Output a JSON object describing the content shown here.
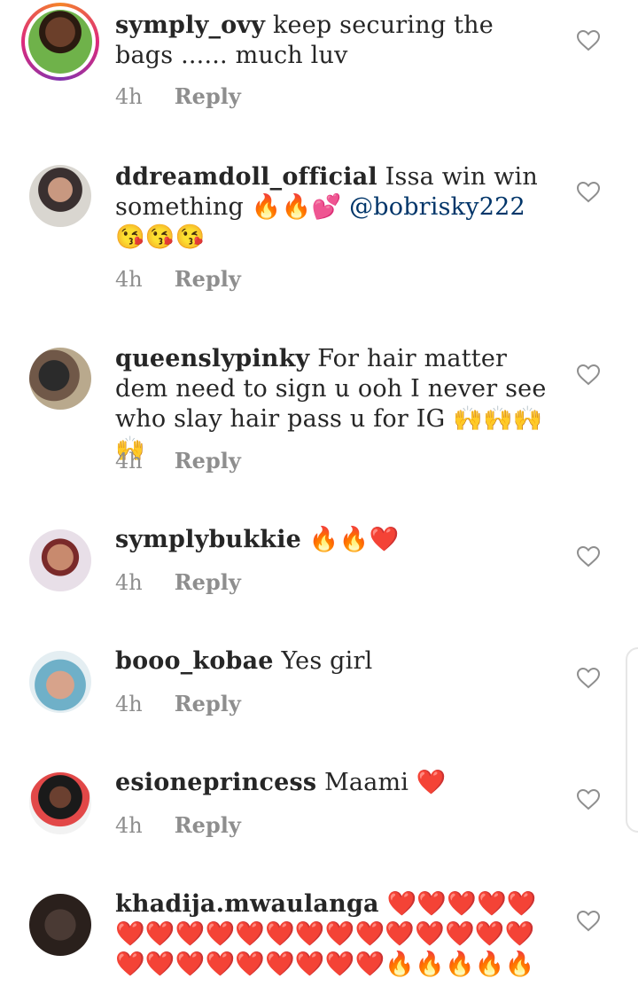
{
  "comments": [
    {
      "username": "symply_ovy",
      "text": "keep securing the bags ...... much luv",
      "time": "4h",
      "reply": "Reply"
    },
    {
      "username": "ddreamdoll_official",
      "text": "Issa win win something 🔥🔥💕 ",
      "mention": "@bobrisky222",
      "text_after": " 😘😘😘",
      "time": "4h",
      "reply": "Reply"
    },
    {
      "username": "queenslypinky",
      "text": "For hair matter dem need to sign u ooh I never see who slay hair pass u for IG 🙌🙌🙌🙌",
      "time": "4h",
      "reply": "Reply"
    },
    {
      "username": "symplybukkie",
      "text": "🔥🔥❤️",
      "time": "4h",
      "reply": "Reply"
    },
    {
      "username": "booo_kobae",
      "text": "Yes girl",
      "time": "4h",
      "reply": "Reply"
    },
    {
      "username": "esioneprincess",
      "text": "Maami ❤️",
      "time": "4h",
      "reply": "Reply"
    },
    {
      "username": "khadija.mwaulanga",
      "text": "❤️❤️❤️❤️❤️❤️❤️❤️❤️❤️❤️❤️❤️❤️❤️❤️❤️❤️❤️❤️❤️❤️❤️❤️❤️❤️❤️❤️🔥🔥🔥🔥🔥",
      "time": "",
      "reply": ""
    }
  ],
  "colors": {
    "accent_text": "#262626",
    "meta_text": "#8e8e8e",
    "mention": "#003569",
    "story_ring": "#dd2a7b"
  },
  "icons": {
    "like": "heart-outline-icon"
  }
}
